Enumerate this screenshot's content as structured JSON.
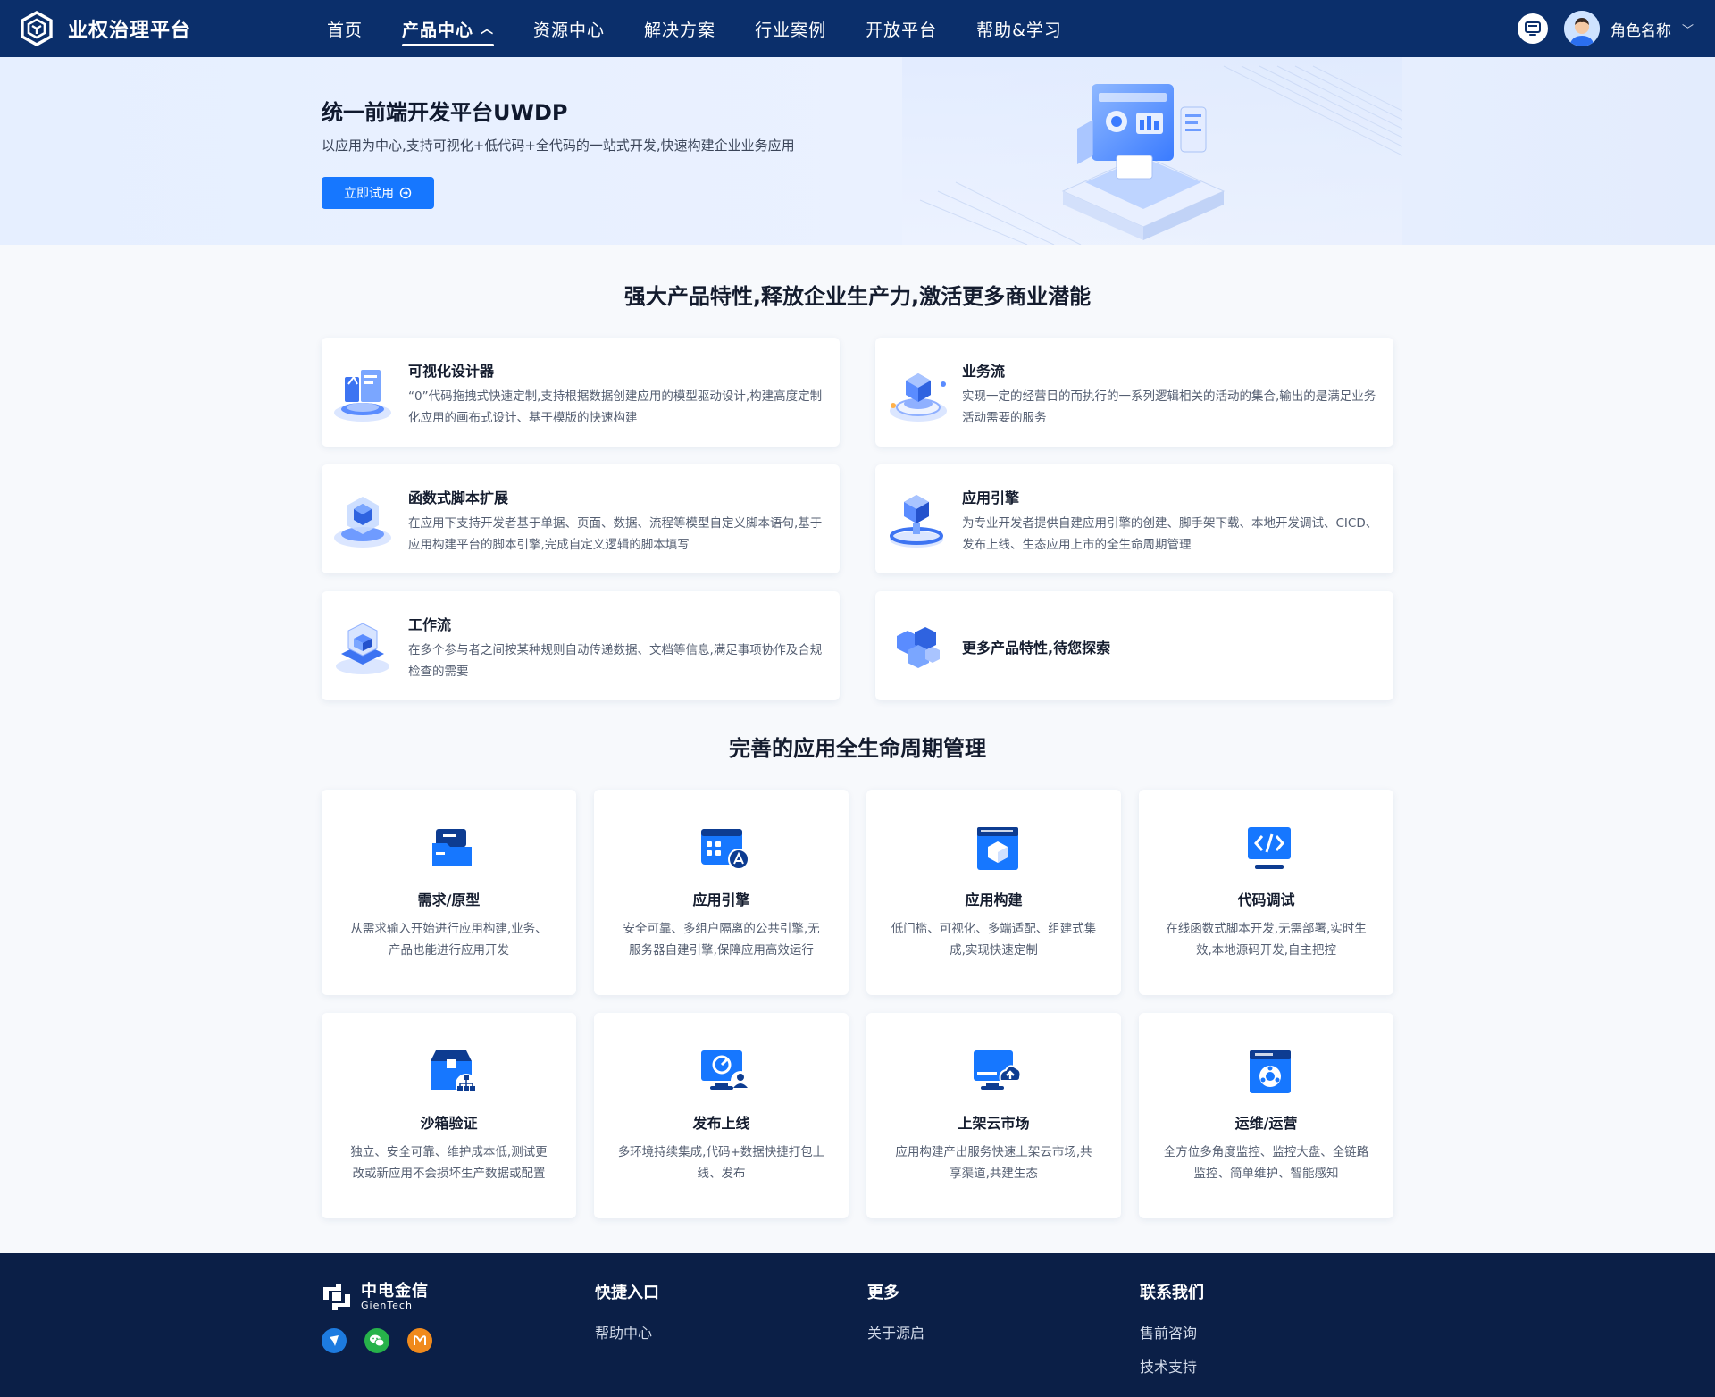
{
  "header": {
    "app_title": "业权治理平台",
    "nav": [
      {
        "label": "首页"
      },
      {
        "label": "产品中心",
        "active": true
      },
      {
        "label": "资源中心"
      },
      {
        "label": "解决方案"
      },
      {
        "label": "行业案例"
      },
      {
        "label": "开放平台"
      },
      {
        "label": "帮助&学习"
      }
    ],
    "user_name": "角色名称"
  },
  "banner": {
    "title": "统一前端开发平台UWDP",
    "subtitle": "以应用为中心,支持可视化+低代码+全代码的一站式开发,快速构建企业业务应用",
    "cta_label": "立即试用"
  },
  "features": {
    "title": "强大产品特性,释放企业生产力,激活更多商业潜能",
    "items": [
      {
        "title": "可视化设计器",
        "desc": "“0”代码拖拽式快速定制,支持根据数据创建应用的模型驱动设计,构建高度定制化应用的画布式设计、基于模版的快速构建",
        "icon": "visual-designer-icon"
      },
      {
        "title": "业务流",
        "desc": "实现一定的经营目的而执行的一系列逻辑相关的活动的集合,输出的是满足业务活动需要的服务",
        "icon": "business-flow-icon"
      },
      {
        "title": "函数式脚本扩展",
        "desc": "在应用下支持开发者基于单据、页面、数据、流程等模型自定义脚本语句,基于应用构建平台的脚本引擎,完成自定义逻辑的脚本填写",
        "icon": "script-extension-icon"
      },
      {
        "title": "应用引擎",
        "desc": "为专业开发者提供自建应用引擎的创建、脚手架下载、本地开发调试、CICD、发布上线、生态应用上市的全生命周期管理",
        "icon": "app-engine-icon"
      },
      {
        "title": "工作流",
        "desc": "在多个参与者之间按某种规则自动传递数据、文档等信息,满足事项协作及合规检查的需要",
        "icon": "workflow-icon"
      },
      {
        "title": "更多产品特性,待您探索",
        "desc": "",
        "icon": "more-features-icon"
      }
    ]
  },
  "lifecycle": {
    "title": "完善的应用全生命周期管理",
    "items": [
      {
        "title": "需求/原型",
        "desc": "从需求输入开始进行应用构建,业务、产品也能进行应用开发",
        "icon": "requirement-icon"
      },
      {
        "title": "应用引擎",
        "desc": "安全可靠、多组户隔离的公共引擎,无服务器自建引擎,保障应用高效运行",
        "icon": "engine-icon"
      },
      {
        "title": "应用构建",
        "desc": "低门槛、可视化、多端适配、组建式集成,实现快速定制",
        "icon": "build-icon"
      },
      {
        "title": "代码调试",
        "desc": "在线函数式脚本开发,无需部署,实时生效,本地源码开发,自主把控",
        "icon": "code-debug-icon"
      },
      {
        "title": "沙箱验证",
        "desc": "独立、安全可靠、维护成本低,测试更改或新应用不会损坏生产数据或配置",
        "icon": "sandbox-icon"
      },
      {
        "title": "发布上线",
        "desc": "多环境持续集成,代码+数据快捷打包上线、发布",
        "icon": "publish-icon"
      },
      {
        "title": "上架云市场",
        "desc": "应用构建产出服务快速上架云市场,共享渠道,共建生态",
        "icon": "cloud-market-icon"
      },
      {
        "title": "运维/运营",
        "desc": "全方位多角度监控、监控大盘、全链路监控、简单维护、智能感知",
        "icon": "operations-icon"
      }
    ]
  },
  "footer": {
    "logo_cn": "中电金信",
    "logo_en": "GienTech",
    "columns": [
      {
        "title": "快捷入口",
        "links": [
          "帮助中心"
        ]
      },
      {
        "title": "更多",
        "links": [
          "关于源启"
        ]
      },
      {
        "title": "联系我们",
        "links": [
          "售前咨询",
          "技术支持"
        ]
      }
    ],
    "social": [
      "weibo-icon",
      "wechat-icon",
      "miniprogram-icon"
    ]
  },
  "colors": {
    "header_bg": "#0b2f6b",
    "primary": "#1677ff",
    "footer_bg": "#0b1f47"
  }
}
